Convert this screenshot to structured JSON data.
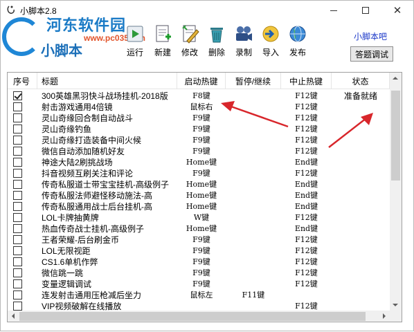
{
  "window": {
    "title": "小脚本2.8"
  },
  "watermark": {
    "site": "河东软件园",
    "url": "www.pc0359.cn",
    "app_name": "小脚本"
  },
  "toolbar": {
    "run": "运行",
    "new": "新建",
    "edit": "修改",
    "delete": "删除",
    "record": "录制",
    "import": "导入",
    "publish": "发布"
  },
  "links": {
    "home": "小脚本吧"
  },
  "buttons": {
    "answer_debug": "答题调试"
  },
  "table": {
    "headers": [
      "序号",
      "标题",
      "启动热键",
      "暂停/继续",
      "中止热键",
      "状态"
    ],
    "rows": [
      {
        "checked": true,
        "title": "300英雄黑羽快斗战场挂机-2018版",
        "start": "F8键",
        "pause": "",
        "stop": "F12键",
        "status": "准备就绪"
      },
      {
        "checked": false,
        "title": "射击游戏通用4倍镜",
        "start": "鼠标右",
        "pause": "",
        "stop": "F12键",
        "status": ""
      },
      {
        "checked": false,
        "title": "灵山奇缘回合制自动战斗",
        "start": "F9键",
        "pause": "",
        "stop": "F12键",
        "status": ""
      },
      {
        "checked": false,
        "title": "灵山奇缘钓鱼",
        "start": "F9键",
        "pause": "",
        "stop": "F12键",
        "status": ""
      },
      {
        "checked": false,
        "title": "灵山奇缘打造装备中间火候",
        "start": "F9键",
        "pause": "",
        "stop": "F12键",
        "status": ""
      },
      {
        "checked": false,
        "title": "微信自动添加随机好友",
        "start": "F9键",
        "pause": "",
        "stop": "F12键",
        "status": ""
      },
      {
        "checked": false,
        "title": "神途大陆2刷挑战场",
        "start": "Home键",
        "pause": "",
        "stop": "End键",
        "status": ""
      },
      {
        "checked": false,
        "title": "抖音视频互刷关注和评论",
        "start": "F9键",
        "pause": "",
        "stop": "F12键",
        "status": ""
      },
      {
        "checked": false,
        "title": "传奇私服道士带宝宝挂机-高级例子",
        "start": "Home键",
        "pause": "",
        "stop": "End键",
        "status": ""
      },
      {
        "checked": false,
        "title": "传奇私服法师避怪移动施法-高",
        "start": "Home键",
        "pause": "",
        "stop": "End键",
        "status": ""
      },
      {
        "checked": false,
        "title": "传奇私服通用战士后台挂机-高",
        "start": "Home键",
        "pause": "",
        "stop": "End键",
        "status": ""
      },
      {
        "checked": false,
        "title": "LOL卡牌抽黄牌",
        "start": "W键",
        "pause": "",
        "stop": "F12键",
        "status": ""
      },
      {
        "checked": false,
        "title": "热血传奇战士挂机-高级例子",
        "start": "Home键",
        "pause": "",
        "stop": "End键",
        "status": ""
      },
      {
        "checked": false,
        "title": "王者荣耀-后台刷金币",
        "start": "F9键",
        "pause": "",
        "stop": "F12键",
        "status": ""
      },
      {
        "checked": false,
        "title": "LOL无限视距",
        "start": "F9键",
        "pause": "",
        "stop": "F12键",
        "status": ""
      },
      {
        "checked": false,
        "title": "CS1.6单机作弊",
        "start": "F9键",
        "pause": "",
        "stop": "F12键",
        "status": ""
      },
      {
        "checked": false,
        "title": "微信跳一跳",
        "start": "F9键",
        "pause": "",
        "stop": "F12键",
        "status": ""
      },
      {
        "checked": false,
        "title": "变量逻辑调试",
        "start": "F9键",
        "pause": "",
        "stop": "F12键",
        "status": ""
      },
      {
        "checked": false,
        "title": "连发射击通用压枪减后坐力",
        "start": "鼠标左",
        "pause": "F11键",
        "stop": "",
        "status": ""
      },
      {
        "checked": false,
        "title": "VIP视频破解在线播放",
        "start": "",
        "pause": "",
        "stop": "F12键",
        "status": ""
      }
    ]
  },
  "colors": {
    "annotation_arrow": "#d8262b",
    "link": "#1a37c8",
    "logo_blue": "#1b7bc6"
  }
}
